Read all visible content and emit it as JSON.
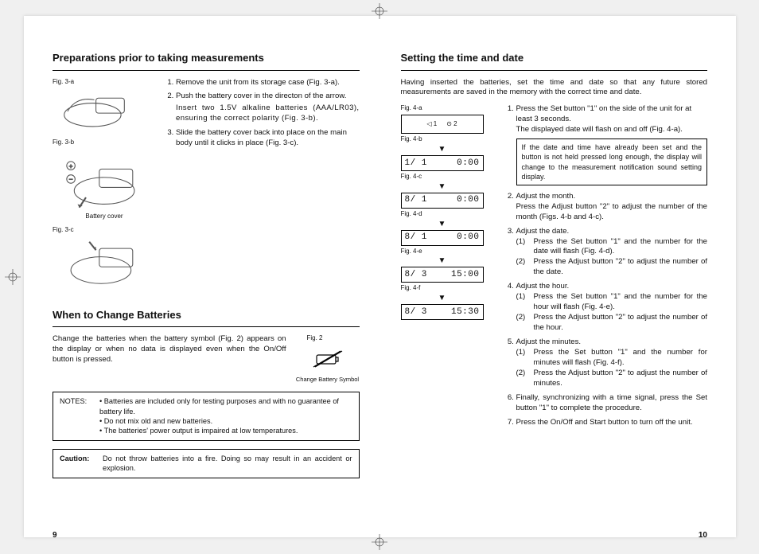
{
  "left": {
    "h1": "Preparations prior to taking measurements",
    "fig_a": "Fig. 3-a",
    "fig_b": "Fig. 3-b",
    "fig_c": "Fig. 3-c",
    "battery_cover": "Battery cover",
    "steps": [
      "Remove the unit from its storage case (Fig. 3-a).",
      "Push the battery cover in the directon of the arrow.",
      "Slide the battery cover back into place on the main body until it clicks in place (Fig. 3-c)."
    ],
    "step2_extra": "Insert two 1.5V alkaline batteries (AAA/LR03), ensuring the correct polarity (Fig. 3-b).",
    "h2": "When to Change Batteries",
    "change_text": "Change the batteries when the battery symbol (Fig. 2) appears on the display or when no data is displayed even when the On/Off button is pressed.",
    "fig2": "Fig. 2",
    "fig2_caption": "Change Battery Symbol",
    "notes_label": "NOTES:",
    "notes": [
      "Batteries are included only for testing purposes and with no guarantee of battery life.",
      "Do not mix old and new batteries.",
      "The batteries' power output is impaired at low temperatures."
    ],
    "caution_label": "Caution:",
    "caution": "Do not throw batteries into a fire. Doing so may result in an accident or explosion.",
    "page": "9"
  },
  "right": {
    "h1": "Setting the time and date",
    "intro": "Having inserted the batteries, set the time and date so that any future stored measurements are saved in the memory with the correct time and date.",
    "figs": [
      "Fig. 4-a",
      "Fig. 4-b",
      "Fig. 4-c",
      "Fig. 4-d",
      "Fig. 4-e",
      "Fig. 4-f"
    ],
    "top_box": {
      "l": "1",
      "r": "2"
    },
    "lcd": [
      {
        "l": "1/ 1",
        "r": "0:00"
      },
      {
        "l": "8/ 1",
        "r": "0:00"
      },
      {
        "l": "8/ 1",
        "r": "0:00"
      },
      {
        "l": "8/ 3",
        "r": "15:00"
      },
      {
        "l": "8/ 3",
        "r": "15:30"
      }
    ],
    "step1a": "Press the Set button \"1\" on the side of the unit for at least 3 seconds.",
    "step1b": "The displayed date will flash on and off (Fig. 4-a).",
    "infobox": "If the date and time have already been set and the button is not held pressed long enough, the display will change to the measurement notification sound setting display.",
    "step2a": "Adjust the month.",
    "step2b": "Press the Adjust button \"2\" to adjust the number of the month (Figs. 4-b and 4-c).",
    "step3a": "Adjust the date.",
    "step3_1": "Press the Set button \"1\" and the number for the date will flash (Fig. 4-d).",
    "step3_2": "Press the Adjust button \"2\" to adjust the number of the date.",
    "step4a": "Adjust the hour.",
    "step4_1": "Press the Set button \"1\" and the number for the hour will flash (Fig. 4-e).",
    "step4_2": "Press the Adjust button \"2\" to adjust the number of the hour.",
    "step5a": "Adjust the minutes.",
    "step5_1": "Press the Set button \"1\" and the number for minutes will flash (Fig. 4-f).",
    "step5_2": "Press the Adjust button \"2\" to adjust the number of minutes.",
    "step6": "Finally, synchronizing with a time signal, press the Set button \"1\" to complete the procedure.",
    "step7": "Press the On/Off and Start button to turn off the unit.",
    "page": "10"
  }
}
